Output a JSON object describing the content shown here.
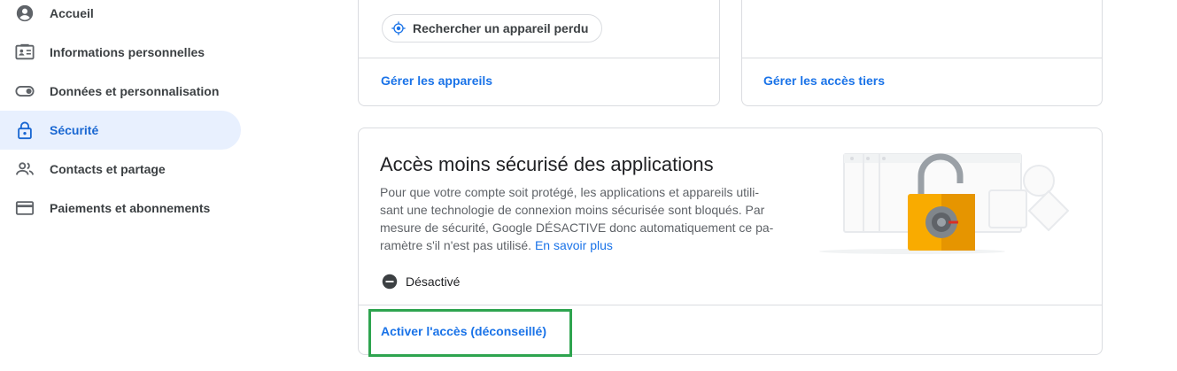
{
  "sidebar": {
    "items": [
      {
        "label": "Accueil",
        "icon": "account-circle-icon",
        "active": false
      },
      {
        "label": "Informations personnelles",
        "icon": "id-card-icon",
        "active": false
      },
      {
        "label": "Données et personnalisation",
        "icon": "toggle-icon",
        "active": false
      },
      {
        "label": "Sécurité",
        "icon": "lock-icon",
        "active": true
      },
      {
        "label": "Contacts et partage",
        "icon": "people-icon",
        "active": false
      },
      {
        "label": "Paiements et abonnements",
        "icon": "credit-card-icon",
        "active": false
      }
    ]
  },
  "devices_card": {
    "find_device_label": "Rechercher un appareil perdu",
    "manage_link": "Gérer les appareils"
  },
  "third_party_card": {
    "manage_link": "Gérer les accès tiers"
  },
  "less_secure_card": {
    "title": "Accès moins sécurisé des applications",
    "desc_lines": [
      "Pour que votre compte soit protégé, les applications et appareils utili-",
      "sant une technologie de connexion moins sécurisée sont bloqués. Par",
      "mesure de sécurité, Google DÉSACTIVE donc automatiquement ce pa-",
      "ramètre s'il n'est pas utilisé."
    ],
    "learn_more": "En savoir plus",
    "status_label": "Désactivé",
    "action_link": "Activer l'accès (déconseillé)"
  },
  "colors": {
    "accent": "#1a73e8",
    "active_bg": "#e8f0fe",
    "highlight": "#2ea44f",
    "lock_yellow": "#f9ab00"
  }
}
